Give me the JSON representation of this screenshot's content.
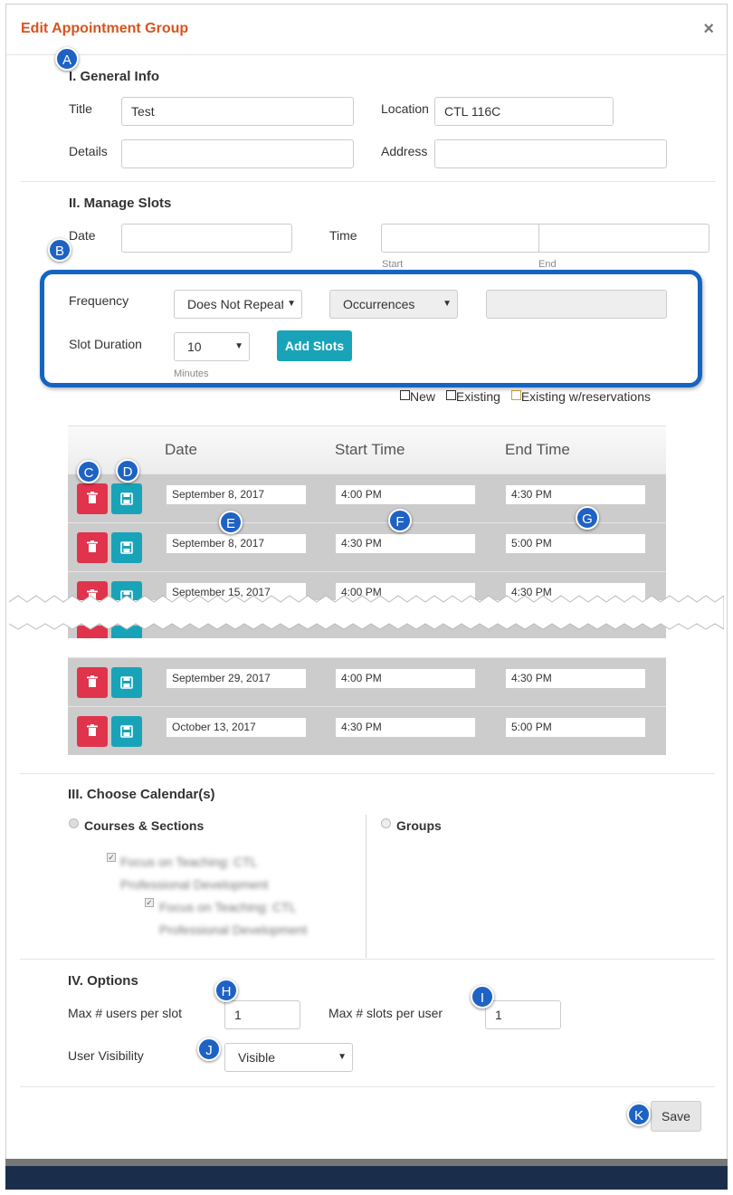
{
  "modal": {
    "title": "Edit Appointment Group",
    "close_glyph": "×"
  },
  "general": {
    "heading": "I. General Info",
    "title_label": "Title",
    "title_value": "Test",
    "location_label": "Location",
    "location_value": "CTL 116C",
    "details_label": "Details",
    "details_value": "",
    "address_label": "Address",
    "address_value": ""
  },
  "slots": {
    "heading": "II. Manage Slots",
    "date_label": "Date",
    "date_value": "",
    "time_label": "Time",
    "start_hint": "Start",
    "end_hint": "End",
    "frequency_label": "Frequency",
    "frequency_value": "Does Not Repeat",
    "occurrences_value": "Occurrences",
    "duration_label": "Slot Duration",
    "duration_value": "10",
    "minutes_hint": "Minutes",
    "add_slots_label": "Add Slots",
    "legend": [
      "New",
      "Existing",
      "Existing w/reservations"
    ],
    "columns": [
      "Date",
      "Start Time",
      "End Time"
    ],
    "rows_top": [
      {
        "date": "September 8, 2017",
        "start": "4:00 PM",
        "end": "4:30 PM"
      },
      {
        "date": "September 8, 2017",
        "start": "4:30 PM",
        "end": "5:00 PM"
      },
      {
        "date": "September 15, 2017",
        "start": "4:00 PM",
        "end": "4:30 PM"
      }
    ],
    "rows_bottom": [
      {
        "date": "September 29, 2017",
        "start": "4:00 PM",
        "end": "4:30 PM"
      },
      {
        "date": "October 13, 2017",
        "start": "4:30 PM",
        "end": "5:00 PM"
      }
    ]
  },
  "calendars": {
    "heading": "III. Choose Calendar(s)",
    "courses_label": "Courses & Sections",
    "groups_label": "Groups",
    "course_item_1": "Focus on Teaching: CTL Professional Development",
    "course_item_2": "Focus on Teaching: CTL Professional Development"
  },
  "options": {
    "heading": "IV. Options",
    "max_users_label": "Max # users per slot",
    "max_users_value": "1",
    "max_slots_label": "Max # slots per user",
    "max_slots_value": "1",
    "visibility_label": "User Visibility",
    "visibility_value": "Visible"
  },
  "footer": {
    "save_label": "Save"
  },
  "markers": {
    "a": "A",
    "b": "B",
    "c": "C",
    "d": "D",
    "e": "E",
    "f": "F",
    "g": "G",
    "h": "H",
    "i": "I",
    "j": "J",
    "k": "K"
  },
  "colors": {
    "title_orange": "#d9531e",
    "teal": "#19a3b8",
    "red": "#e0344c",
    "marker_blue": "#1e62c4"
  }
}
